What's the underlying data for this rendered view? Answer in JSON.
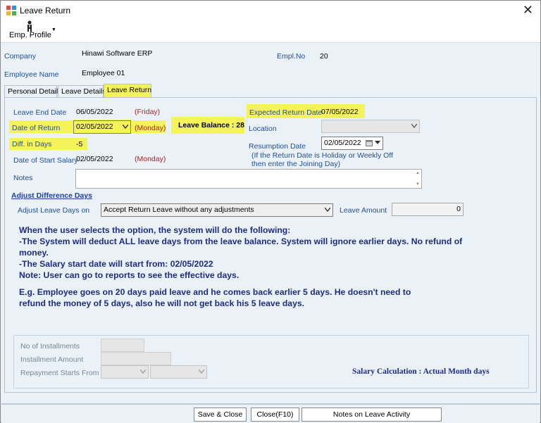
{
  "window": {
    "title": "Leave Return"
  },
  "toolbar": {
    "emp_profile_label": "Emp. Profile"
  },
  "header": {
    "company_label": "Company",
    "company_value": "Hinawi Software ERP",
    "empl_no_label": "Empl.No",
    "empl_no_value": "20",
    "employee_name_label": "Employee Name",
    "employee_name_value": "Employee 01"
  },
  "tabs": [
    {
      "label": "Personal Details"
    },
    {
      "label": "Leave Details"
    },
    {
      "label": "Leave Return"
    }
  ],
  "form": {
    "leave_end_date_label": "Leave End Date",
    "leave_end_date_value": "06/05/2022",
    "leave_end_day": "(Friday)",
    "date_of_return_label": "Date of Return",
    "date_of_return_value": "02/05/2022",
    "date_of_return_day": "(Monday)",
    "leave_balance": "Leave Balance : 28",
    "diff_in_days_label": "Diff. in Days",
    "diff_in_days_value": "-5",
    "date_of_start_salary_label": "Date of Start Salary",
    "date_of_start_salary_value": "02/05/2022",
    "date_of_start_salary_day": "(Monday)",
    "expected_return_date_label": "Expected Return Date",
    "expected_return_date_value": "07/05/2022",
    "location_label": "Location",
    "location_value": "",
    "resumption_date_label": "Resumption Date",
    "resumption_date_value": "02/05/2022",
    "resumption_note_line1": "(If the Return Date is Holiday or Weekly Off",
    "resumption_note_line2": "then enter the Joining Day)",
    "notes_label": "Notes",
    "notes_value": ""
  },
  "adjust": {
    "section_title": "Adjust Difference Days",
    "adjust_leave_days_label": "Adjust Leave Days on",
    "adjust_leave_days_value": "Accept Return Leave without any adjustments",
    "leave_amount_label": "Leave Amount",
    "leave_amount_value": "0"
  },
  "info": {
    "line1": "When the user selects the option, the system will do the following:",
    "line2": "-The System will deduct ALL leave days from the leave balance. System will ignore earlier days. No refund of",
    "line3": "money.",
    "line4": "-The Salary start date will start from: 02/05/2022",
    "line5": "Note: User can go to reports to see the effective days.",
    "line6": "E.g. Employee goes on 20 days paid leave and he comes back earlier 5 days. He doesn't need to",
    "line7": "refund the money of 5 days, also he will not get back his 5 leave days."
  },
  "installments": {
    "no_of_installments_label": "No of Installments",
    "installment_amount_label": "Installment Amount",
    "repayment_starts_from_label": "Repayment Starts From",
    "salary_calculation": "Salary Calculation : Actual Month days"
  },
  "buttons": {
    "save_close": "Save & Close",
    "close": "Close(F10)",
    "notes_on_leave_activity": "Notes on Leave Activity"
  },
  "colors": {
    "highlight": "#f5f35a",
    "label_blue": "#1f4e9c",
    "day_red": "#b22222",
    "info_navy": "#1d2c86"
  }
}
